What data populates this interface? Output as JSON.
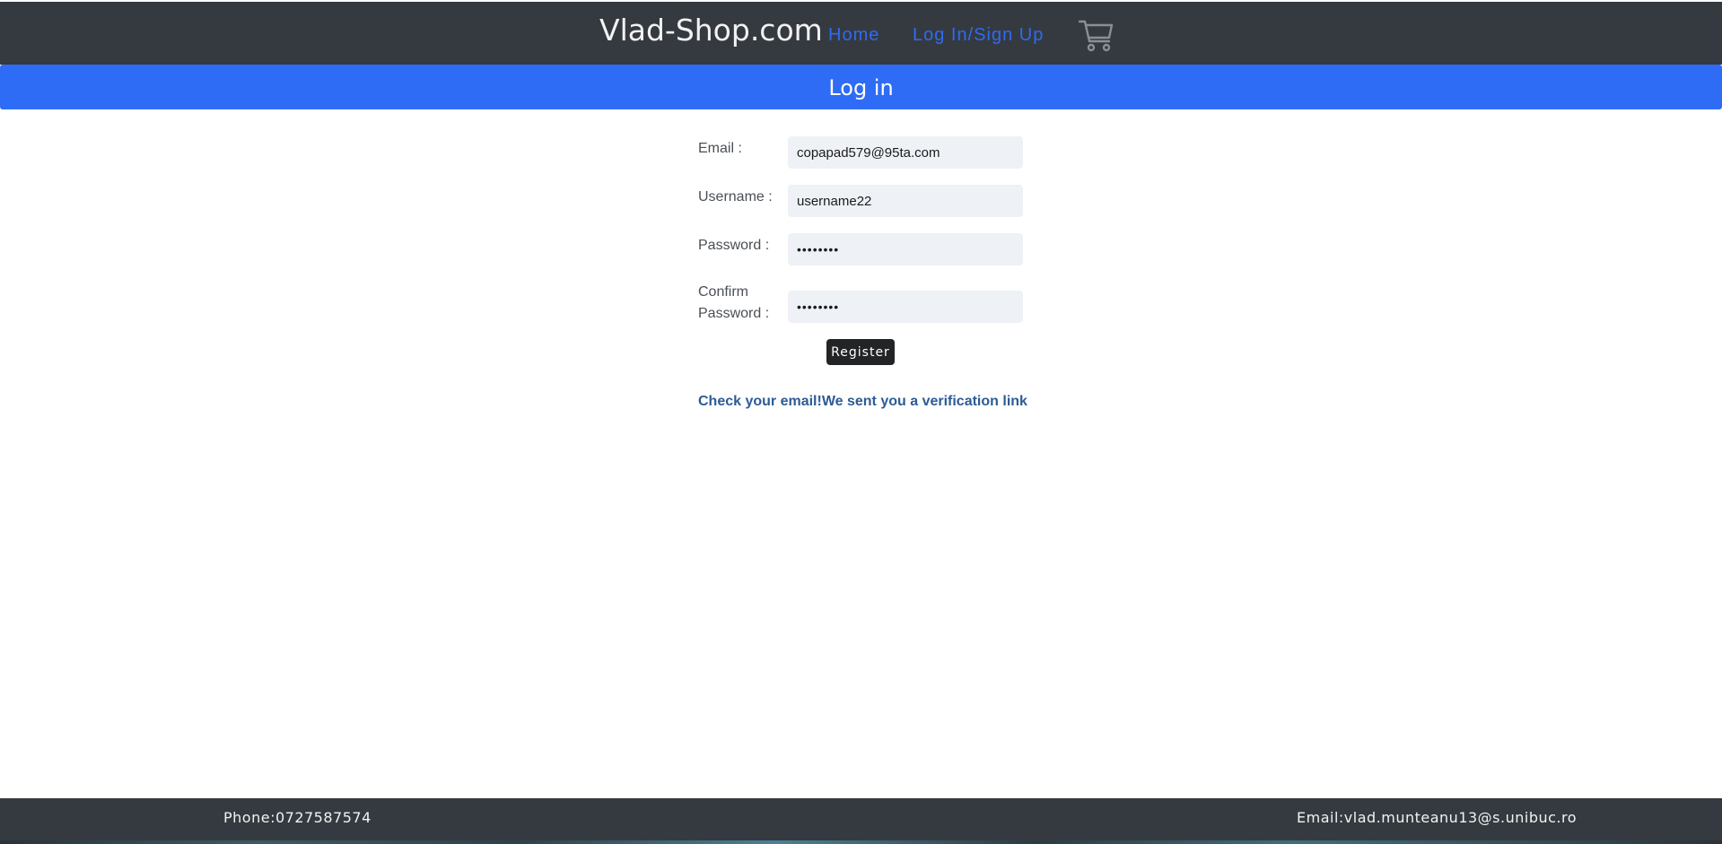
{
  "navbar": {
    "brand": "Vlad-Shop.com",
    "links": [
      {
        "label": "Home"
      },
      {
        "label": "Log In/Sign Up"
      }
    ],
    "cart_icon": "shopping-cart-icon"
  },
  "banner": {
    "title": "Log in"
  },
  "form": {
    "email_label": "Email :",
    "email_value": "copapad579@95ta.com",
    "username_label": "Username :",
    "username_value": "username22",
    "password_label": "Password :",
    "password_value": "••••••••",
    "confirm_label_line1": "Confirm",
    "confirm_label_line2": "Password :",
    "confirm_value": "••••••••",
    "register_label": "Register"
  },
  "notice": "Check your email!We sent you a verification link",
  "footer": {
    "phone": "Phone:0727587574",
    "email": "Email:vlad.munteanu13@s.unibuc.ro"
  },
  "colors": {
    "navbar_bg": "#343a40",
    "accent_blue": "#2e6cf6",
    "link_blue": "#2f6bf0",
    "notice_blue": "#2d5b95",
    "button_dark": "#222426"
  }
}
